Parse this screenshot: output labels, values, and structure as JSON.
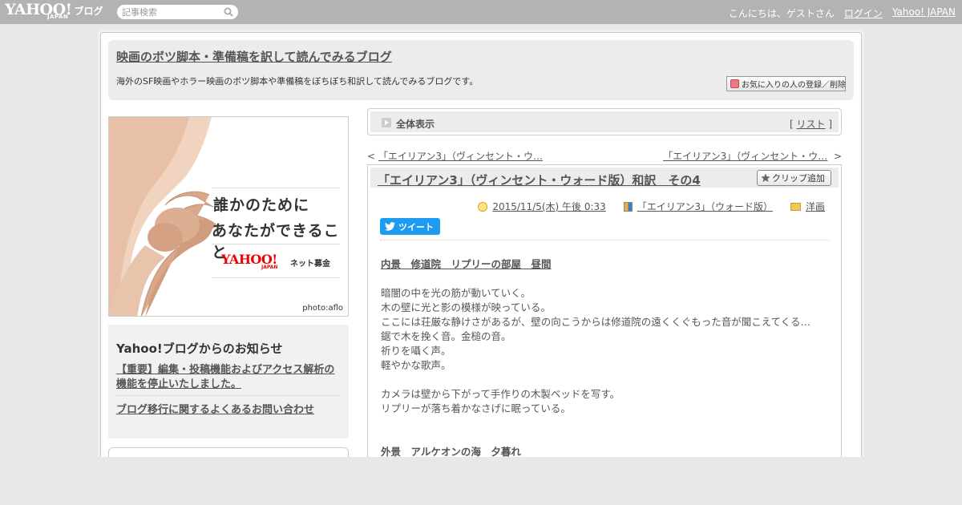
{
  "topbar": {
    "logo_text": "YAHOO!",
    "logo_sub": "JAPAN",
    "logo_blog": "ブログ",
    "search_placeholder": "記事検索",
    "greeting": "こんにちは、ゲストさん",
    "login": "ログイン",
    "yahoo_japan": "Yahoo! JAPAN"
  },
  "header": {
    "blog_title": "映画のボツ脚本・準備稿を訳して読んでみるブログ",
    "blog_description": "海外のSF映画やホラー映画のボツ脚本や準備稿をぼちぼち和訳して読んでみるブログです。",
    "favorite_button": "お気に入りの人の登録／削除"
  },
  "banner": {
    "line1": "誰かのために",
    "line2": "あなたができること",
    "logo": "YAHOO!",
    "logo_sub": "JAPAN",
    "boshu": "ネット募金",
    "photo_credit": "photo:aflo"
  },
  "notice": {
    "title": "Yahoo!ブログからのお知らせ",
    "link1": "【重要】編集・投稿機能およびアクセス解析の機能を停止いたしました。",
    "link2": "ブログ移行に関するよくあるお問い合わせ"
  },
  "nav": {
    "all_view": "全体表示",
    "list_open": "[ ",
    "list_label": "リスト",
    "list_close": " ]",
    "prev_arrow": "< ",
    "prev_title": "「エイリアン3」（ヴィンセント・ウ…",
    "next_title": "「エイリアン3」（ヴィンセント・ウ…",
    "next_arrow": "  >"
  },
  "article": {
    "title": "「エイリアン3」（ヴィンセント・ウォード版）和訳　その4",
    "clip_button": "クリップ追加",
    "datetime": "2015/11/5(木) 午後 0:33",
    "category": "「エイリアン3」（ウォード版）",
    "genre": "洋画",
    "tweet": "ツイート",
    "lines": [
      {
        "text": "内景　修道院　リプリーの部屋　昼間",
        "style": "heading"
      },
      {
        "text": "",
        "style": ""
      },
      {
        "text": "暗闇の中を光の筋が動いていく。",
        "style": ""
      },
      {
        "text": "木の壁に光と影の模様が映っている。",
        "style": ""
      },
      {
        "text": "ここには荘厳な静けさがあるが、壁の向こうからは修道院の遠くくぐもった音が聞こえてくる…",
        "style": ""
      },
      {
        "text": "鋸で木を挽く音。金槌の音。",
        "style": ""
      },
      {
        "text": "祈りを囁く声。",
        "style": ""
      },
      {
        "text": "軽やかな歌声。",
        "style": ""
      },
      {
        "text": "",
        "style": ""
      },
      {
        "text": "カメラは壁から下がって手作りの木製ベッドを写す。",
        "style": ""
      },
      {
        "text": "リプリーが落ち着かなさげに眠っている。",
        "style": ""
      },
      {
        "text": "",
        "style": ""
      },
      {
        "text": "",
        "style": ""
      },
      {
        "text": "外景　アルケオンの海　夕暮れ",
        "style": "heading2"
      }
    ]
  },
  "colors": {
    "topbar": "#b3b3b3",
    "tweet": "#1d9bf0",
    "background": "#e8e8e8"
  }
}
